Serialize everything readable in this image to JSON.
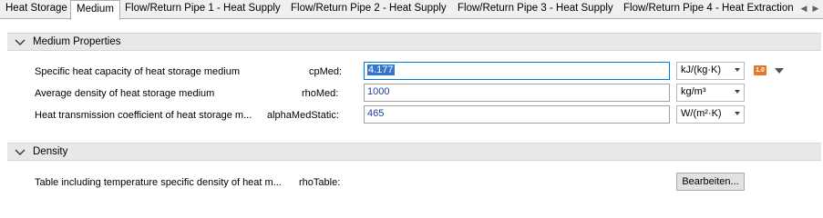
{
  "tabs": [
    {
      "label": "Heat Storage",
      "active": false
    },
    {
      "label": "Medium",
      "active": true
    },
    {
      "label": "Flow/Return Pipe 1 - Heat Supply",
      "active": false
    },
    {
      "label": "Flow/Return Pipe 2 - Heat Supply",
      "active": false
    },
    {
      "label": "Flow/Return Pipe 3 - Heat Supply",
      "active": false
    },
    {
      "label": "Flow/Return Pipe 4 - Heat Extraction",
      "active": false
    }
  ],
  "sections": {
    "medium": {
      "title": "Medium Properties",
      "rows": [
        {
          "label": "Specific heat capacity of heat storage medium",
          "var": "cpMed:",
          "value": "4.177",
          "unit": "kJ/(kg·K)",
          "badge": "1.0"
        },
        {
          "label": "Average density of heat storage medium",
          "var": "rhoMed:",
          "value": "1000",
          "unit": "kg/m³"
        },
        {
          "label": "Heat transmission coefficient of heat storage m...",
          "var": "alphaMedStatic:",
          "value": "465",
          "unit": "W/(m²·K)"
        }
      ]
    },
    "density": {
      "title": "Density",
      "row": {
        "label": "Table including temperature specific density of heat m...",
        "var": "rhoTable:",
        "button": "Bearbeiten..."
      }
    }
  }
}
